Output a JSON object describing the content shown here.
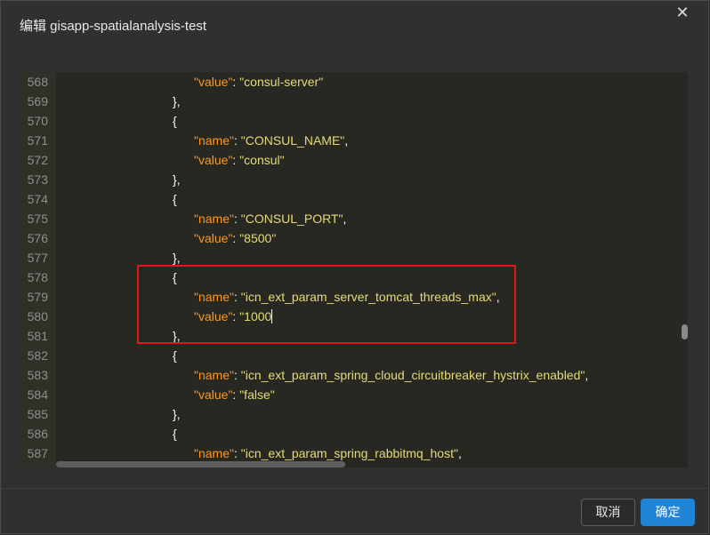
{
  "dialog": {
    "title": "编辑 gisapp-spatialanalysis-test",
    "close_icon": "close-icon"
  },
  "editor": {
    "lines": [
      {
        "num": "568",
        "indent": "        ",
        "parts": [
          [
            "k",
            "\"value\""
          ],
          [
            "p",
            ": "
          ],
          [
            "s",
            "\"consul-server\""
          ]
        ]
      },
      {
        "num": "569",
        "indent": "      ",
        "parts": [
          [
            "p",
            "},"
          ]
        ]
      },
      {
        "num": "570",
        "indent": "      ",
        "parts": [
          [
            "p",
            "{"
          ]
        ]
      },
      {
        "num": "571",
        "indent": "        ",
        "parts": [
          [
            "k",
            "\"name\""
          ],
          [
            "p",
            ": "
          ],
          [
            "s",
            "\"CONSUL_NAME\""
          ],
          [
            "p",
            ","
          ]
        ]
      },
      {
        "num": "572",
        "indent": "        ",
        "parts": [
          [
            "k",
            "\"value\""
          ],
          [
            "p",
            ": "
          ],
          [
            "s",
            "\"consul\""
          ]
        ]
      },
      {
        "num": "573",
        "indent": "      ",
        "parts": [
          [
            "p",
            "},"
          ]
        ]
      },
      {
        "num": "574",
        "indent": "      ",
        "parts": [
          [
            "p",
            "{"
          ]
        ]
      },
      {
        "num": "575",
        "indent": "        ",
        "parts": [
          [
            "k",
            "\"name\""
          ],
          [
            "p",
            ": "
          ],
          [
            "s",
            "\"CONSUL_PORT\""
          ],
          [
            "p",
            ","
          ]
        ]
      },
      {
        "num": "576",
        "indent": "        ",
        "parts": [
          [
            "k",
            "\"value\""
          ],
          [
            "p",
            ": "
          ],
          [
            "s",
            "\"8500\""
          ]
        ]
      },
      {
        "num": "577",
        "indent": "      ",
        "parts": [
          [
            "p",
            "},"
          ]
        ]
      },
      {
        "num": "578",
        "indent": "      ",
        "parts": [
          [
            "p",
            "{"
          ]
        ]
      },
      {
        "num": "579",
        "indent": "        ",
        "parts": [
          [
            "k",
            "\"name\""
          ],
          [
            "p",
            ": "
          ],
          [
            "s",
            "\"icn_ext_param_server_tomcat_threads_max\""
          ],
          [
            "p",
            ","
          ]
        ]
      },
      {
        "num": "580",
        "indent": "        ",
        "parts": [
          [
            "k",
            "\"value\""
          ],
          [
            "p",
            ": "
          ],
          [
            "s",
            "\"1000"
          ],
          [
            "cursor",
            ""
          ]
        ]
      },
      {
        "num": "581",
        "indent": "      ",
        "parts": [
          [
            "p",
            "},"
          ]
        ]
      },
      {
        "num": "582",
        "indent": "      ",
        "parts": [
          [
            "p",
            "{"
          ]
        ]
      },
      {
        "num": "583",
        "indent": "        ",
        "parts": [
          [
            "k",
            "\"name\""
          ],
          [
            "p",
            ": "
          ],
          [
            "s",
            "\"icn_ext_param_spring_cloud_circuitbreaker_hystrix_enabled\""
          ],
          [
            "p",
            ","
          ]
        ]
      },
      {
        "num": "584",
        "indent": "        ",
        "parts": [
          [
            "k",
            "\"value\""
          ],
          [
            "p",
            ": "
          ],
          [
            "s",
            "\"false\""
          ]
        ]
      },
      {
        "num": "585",
        "indent": "      ",
        "parts": [
          [
            "p",
            "},"
          ]
        ]
      },
      {
        "num": "586",
        "indent": "      ",
        "parts": [
          [
            "p",
            "{"
          ]
        ]
      },
      {
        "num": "587",
        "indent": "        ",
        "parts": [
          [
            "k",
            "\"name\""
          ],
          [
            "p",
            ": "
          ],
          [
            "s",
            "\"icn_ext_param_spring_rabbitmq_host\""
          ],
          [
            "p",
            ","
          ]
        ]
      }
    ]
  },
  "footer": {
    "cancel_label": "取消",
    "ok_label": "确定"
  },
  "colors": {
    "key": "#fd971f",
    "string": "#e6db74",
    "highlight_border": "#e01818",
    "primary_button": "#1f83d6"
  }
}
